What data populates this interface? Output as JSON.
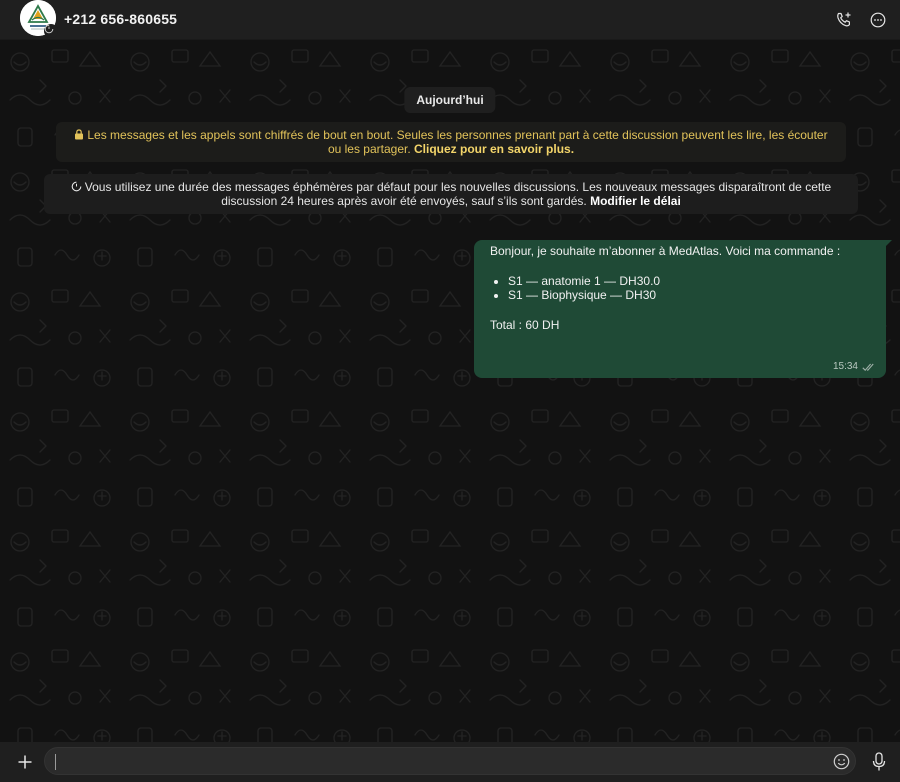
{
  "header": {
    "contact_name": "+212 656-860655",
    "avatar_logo_text": "ATLAS"
  },
  "chat": {
    "date_chip": "Aujourd’hui",
    "encryption_notice": {
      "text": "Les messages et les appels sont chiffrés de bout en bout. Seules les personnes prenant part à cette discussion peuvent les lire, les écouter ou les partager.",
      "link": "Cliquez pour en savoir plus."
    },
    "ephemeral_notice": {
      "text": "Vous utilisez une durée des messages éphémères par défaut pour les nouvelles discussions. Les nouveaux messages disparaîtront de cette discussion 24 heures après avoir été envoyés, sauf s’ils sont gardés.",
      "link": "Modifier le délai"
    },
    "messages": [
      {
        "direction": "outgoing",
        "intro": "Bonjour, je souhaite m’abonner à MedAtlas. Voici ma commande :",
        "items": [
          "S1 — anatomie 1 — DH30.0",
          "S1 — Biophysique — DH30"
        ],
        "total": "Total : 60 DH",
        "time": "15:34",
        "status": "read"
      }
    ]
  },
  "composer": {
    "placeholder": ""
  },
  "icons": {
    "header_actions": [
      "add-call-icon",
      "more-options-icon"
    ],
    "composer": [
      "plus-icon",
      "emoji-icon",
      "microphone-icon"
    ]
  },
  "colors": {
    "outgoing_bubble": "#1f4a36",
    "encryption_notice_text": "#e2c35a",
    "header_bg": "#1f1f1f",
    "chat_bg": "#121212"
  }
}
